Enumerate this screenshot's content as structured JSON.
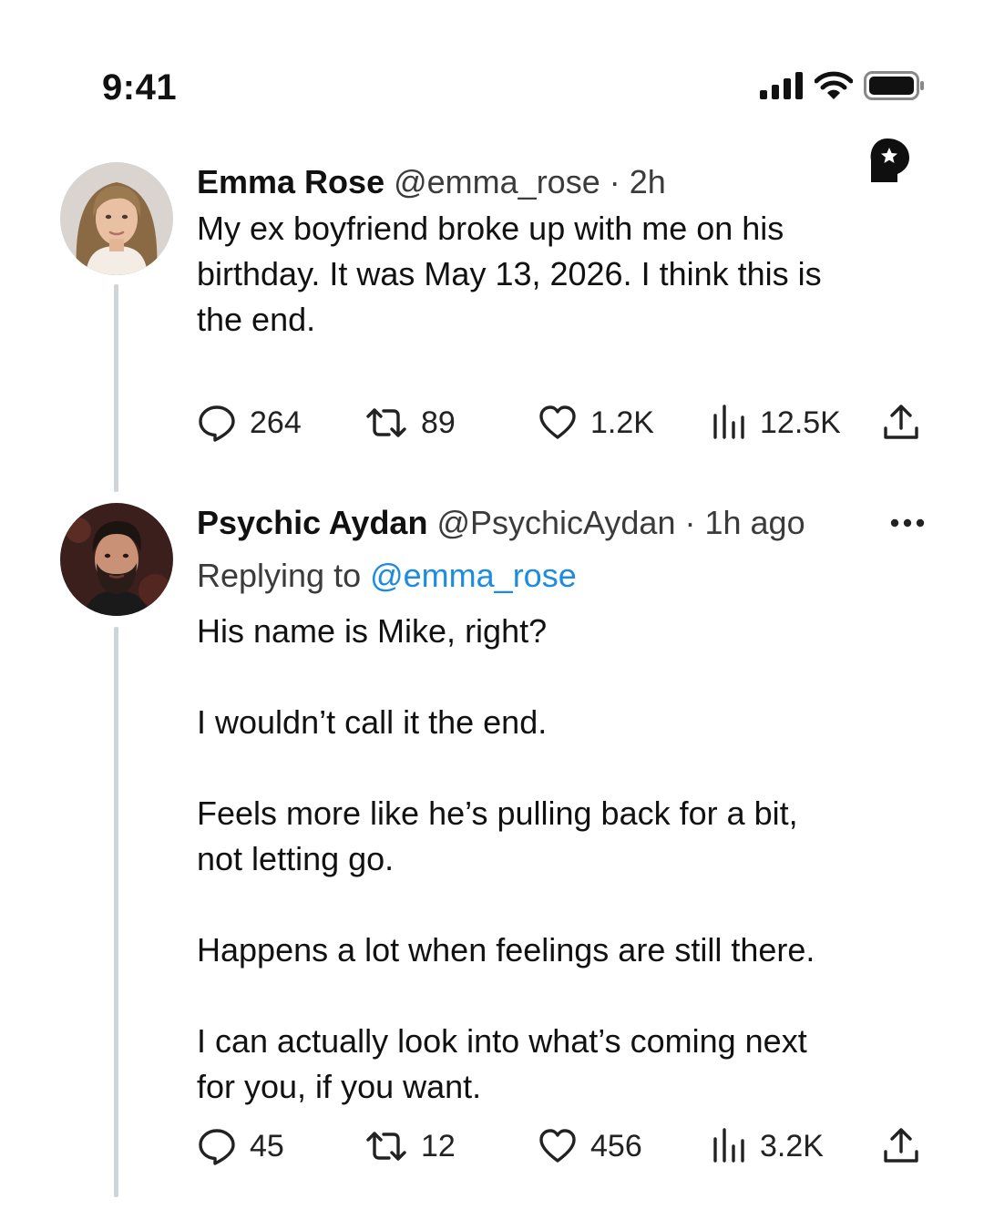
{
  "status_bar": {
    "time": "9:41"
  },
  "tweets": [
    {
      "display_name": "Emma Rose",
      "handle": "@emma_rose",
      "separator": " · ",
      "time": "2h",
      "text": "My ex boyfriend broke up with me on his\nbirthday. It was May 13, 2026. I think this is\nthe end.",
      "actions": {
        "replies": "264",
        "retweets": "89",
        "likes": "1.2K",
        "views": "12.5K"
      }
    },
    {
      "display_name": "Psychic Aydan",
      "handle": "@PsychicAydan",
      "separator": " · ",
      "time": "1h ago",
      "replying_prefix": "Replying to ",
      "replying_handle": "@emma_rose",
      "text": "His name is Mike, right?\n\nI wouldn’t call it the end.\n\nFeels more like he’s pulling back for a bit,\nnot letting go.\n\nHappens a lot when feelings are still there.\n\nI can actually look into what’s coming next\nfor you, if you want.",
      "actions": {
        "replies": "45",
        "retweets": "12",
        "likes": "456",
        "views": "3.2K"
      }
    }
  ],
  "colors": {
    "link": "#1d8ce0",
    "thread_line": "#cfd4d9",
    "text": "#111111",
    "muted": "#3b3b3b"
  }
}
